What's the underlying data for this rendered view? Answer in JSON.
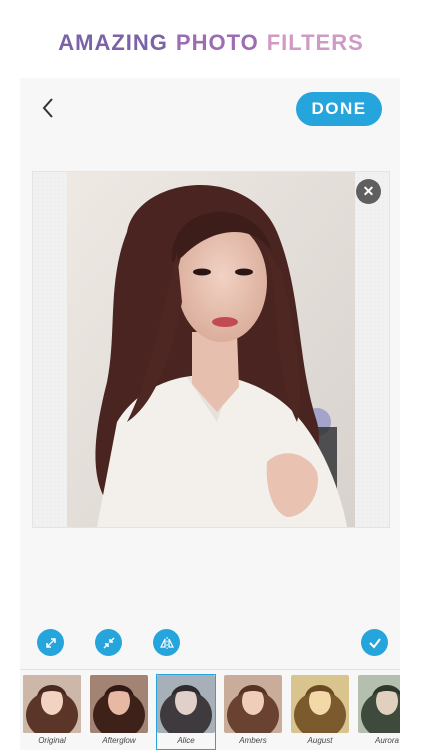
{
  "promo": {
    "word1": "AMAZING",
    "word2": "PHOTO",
    "word3": "FILTERS",
    "colors": [
      "#7a63a6",
      "#a36fb3",
      "#c78bc0"
    ]
  },
  "header": {
    "back_icon": "chevron-left-icon",
    "done_label": "DONE"
  },
  "canvas": {
    "remove_icon": "close-icon"
  },
  "tools": [
    {
      "name": "expand-icon"
    },
    {
      "name": "shrink-icon"
    },
    {
      "name": "flip-horizontal-icon"
    },
    {
      "name": "check-icon"
    }
  ],
  "filters": [
    {
      "label": "Original",
      "selected": false,
      "tint": "#7c5846"
    },
    {
      "label": "Afterglow",
      "selected": false,
      "tint": "#6c4a3c"
    },
    {
      "label": "Alice",
      "selected": true,
      "tint": "#5d6470"
    },
    {
      "label": "Ambers",
      "selected": false,
      "tint": "#8a6653"
    },
    {
      "label": "August",
      "selected": false,
      "tint": "#a8894a"
    },
    {
      "label": "Aurora",
      "selected": false,
      "tint": "#5b6f5f"
    }
  ],
  "accent": "#26a5dd"
}
